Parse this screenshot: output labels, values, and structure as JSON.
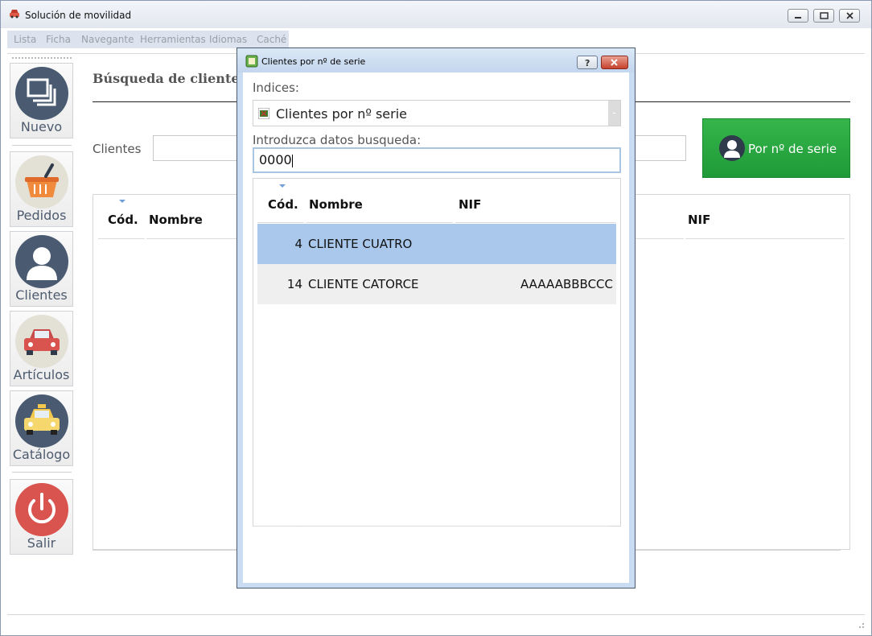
{
  "window": {
    "title": "Solución de movilidad",
    "controls": [
      "minimize-icon",
      "maximize-icon",
      "close-icon"
    ]
  },
  "menu": {
    "items": [
      "Lista",
      "Ficha",
      "Navegante",
      "Herramientas",
      "Idiomas",
      "Caché"
    ]
  },
  "sidebar": {
    "items": [
      {
        "label": "Nuevo",
        "icon": "stack-icon",
        "color": "#4a5a70"
      },
      {
        "label": "Pedidos",
        "icon": "basket-icon",
        "color": "#e3e1d6"
      },
      {
        "label": "Clientes",
        "icon": "user-icon",
        "color": "#4a5a70"
      },
      {
        "label": "Artículos",
        "icon": "car-icon",
        "color": "#e3e1d6"
      },
      {
        "label": "Catálogo",
        "icon": "taxi-icon",
        "color": "#4a5a70"
      },
      {
        "label": "Salir",
        "icon": "power-icon",
        "color": "#d9534f"
      }
    ]
  },
  "page": {
    "heading": "Búsqueda de clientes",
    "clients_label": "Clientes",
    "clients_value": "",
    "search_button": "Por nº de serie",
    "columns": [
      "Cód.",
      "Nombre",
      "NIF"
    ]
  },
  "dialog": {
    "title": "Clientes por nº de serie",
    "indices_label": "Indices:",
    "index_selected": "Clientes por nº serie",
    "search_label": "Introduzca datos busqueda:",
    "search_value": "0000",
    "columns": [
      "Cód.",
      "Nombre",
      "NIF"
    ],
    "rows": [
      {
        "cod": "4",
        "nombre": "CLIENTE CUATRO",
        "nif": "",
        "selected": true
      },
      {
        "cod": "14",
        "nombre": "CLIENTE CATORCE",
        "nif": "AAAAABBBCCC",
        "selected": false
      }
    ]
  },
  "colors": {
    "accent_green": "#1f9a38",
    "selected_row": "#a9c8ec",
    "alt_row": "#efefef"
  }
}
